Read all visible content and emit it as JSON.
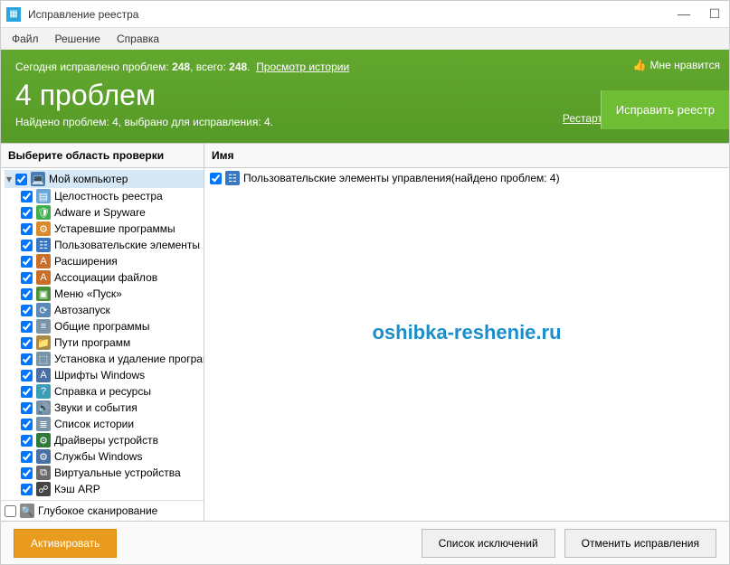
{
  "window": {
    "title": "Исправление реестра"
  },
  "menu": {
    "file": "Файл",
    "solution": "Решение",
    "help": "Справка"
  },
  "banner": {
    "stats_prefix": "Сегодня исправлено проблем: ",
    "fixed_today": "248",
    "stats_mid": ", всего: ",
    "fixed_total": "248",
    "stats_suffix": ".",
    "history_link": "Просмотр истории",
    "big_title": "4 проблем",
    "sub_line": "Найдено проблем: 4, выбрано для исправления: 4.",
    "restart": "Рестарт",
    "fix_button": "Исправить реестр",
    "like": "Мне нравится"
  },
  "left": {
    "header": "Выберите область проверки",
    "root_label": "Мой компьютер",
    "items": [
      {
        "label": "Целостность реестра",
        "color": "#6aa7d6",
        "glyph": "▤"
      },
      {
        "label": "Adware и Spyware",
        "color": "#3fae4c",
        "glyph": "🛡"
      },
      {
        "label": "Устаревшие программы",
        "color": "#d98b2b",
        "glyph": "⚙"
      },
      {
        "label": "Пользовательские элементы",
        "color": "#3a77c2",
        "glyph": "☷"
      },
      {
        "label": "Расширения",
        "color": "#c96f2a",
        "glyph": "A"
      },
      {
        "label": "Ассоциации файлов",
        "color": "#c96f2a",
        "glyph": "A"
      },
      {
        "label": "Меню «Пуск»",
        "color": "#4a9038",
        "glyph": "▣"
      },
      {
        "label": "Автозапуск",
        "color": "#5c88b8",
        "glyph": "⟳"
      },
      {
        "label": "Общие программы",
        "color": "#7a95aa",
        "glyph": "≡"
      },
      {
        "label": "Пути программ",
        "color": "#a68b4a",
        "glyph": "📁"
      },
      {
        "label": "Установка и удаление программ",
        "color": "#7a95aa",
        "glyph": "⬚"
      },
      {
        "label": "Шрифты Windows",
        "color": "#4a6fa5",
        "glyph": "A"
      },
      {
        "label": "Справка и ресурсы",
        "color": "#3a9fb5",
        "glyph": "?"
      },
      {
        "label": "Звуки и события",
        "color": "#7590a8",
        "glyph": "🔊"
      },
      {
        "label": "Список истории",
        "color": "#7a95aa",
        "glyph": "≣"
      },
      {
        "label": "Драйверы устройств",
        "color": "#2f7a3a",
        "glyph": "⚙"
      },
      {
        "label": "Службы Windows",
        "color": "#4a6fa5",
        "glyph": "⚙"
      },
      {
        "label": "Виртуальные устройства",
        "color": "#6a6a6a",
        "glyph": "⧉"
      },
      {
        "label": "Кэш ARP",
        "color": "#444",
        "glyph": "☍"
      }
    ],
    "deep_scan": "Глубокое сканирование"
  },
  "right": {
    "header": "Имя",
    "rows": [
      {
        "label": "Пользовательские элементы управления(найдено проблем: 4)",
        "color": "#3a77c2",
        "glyph": "☷"
      }
    ]
  },
  "watermark": "oshibka-reshenie.ru",
  "footer": {
    "activate": "Активировать",
    "exclusions": "Список исключений",
    "cancel": "Отменить исправления"
  }
}
